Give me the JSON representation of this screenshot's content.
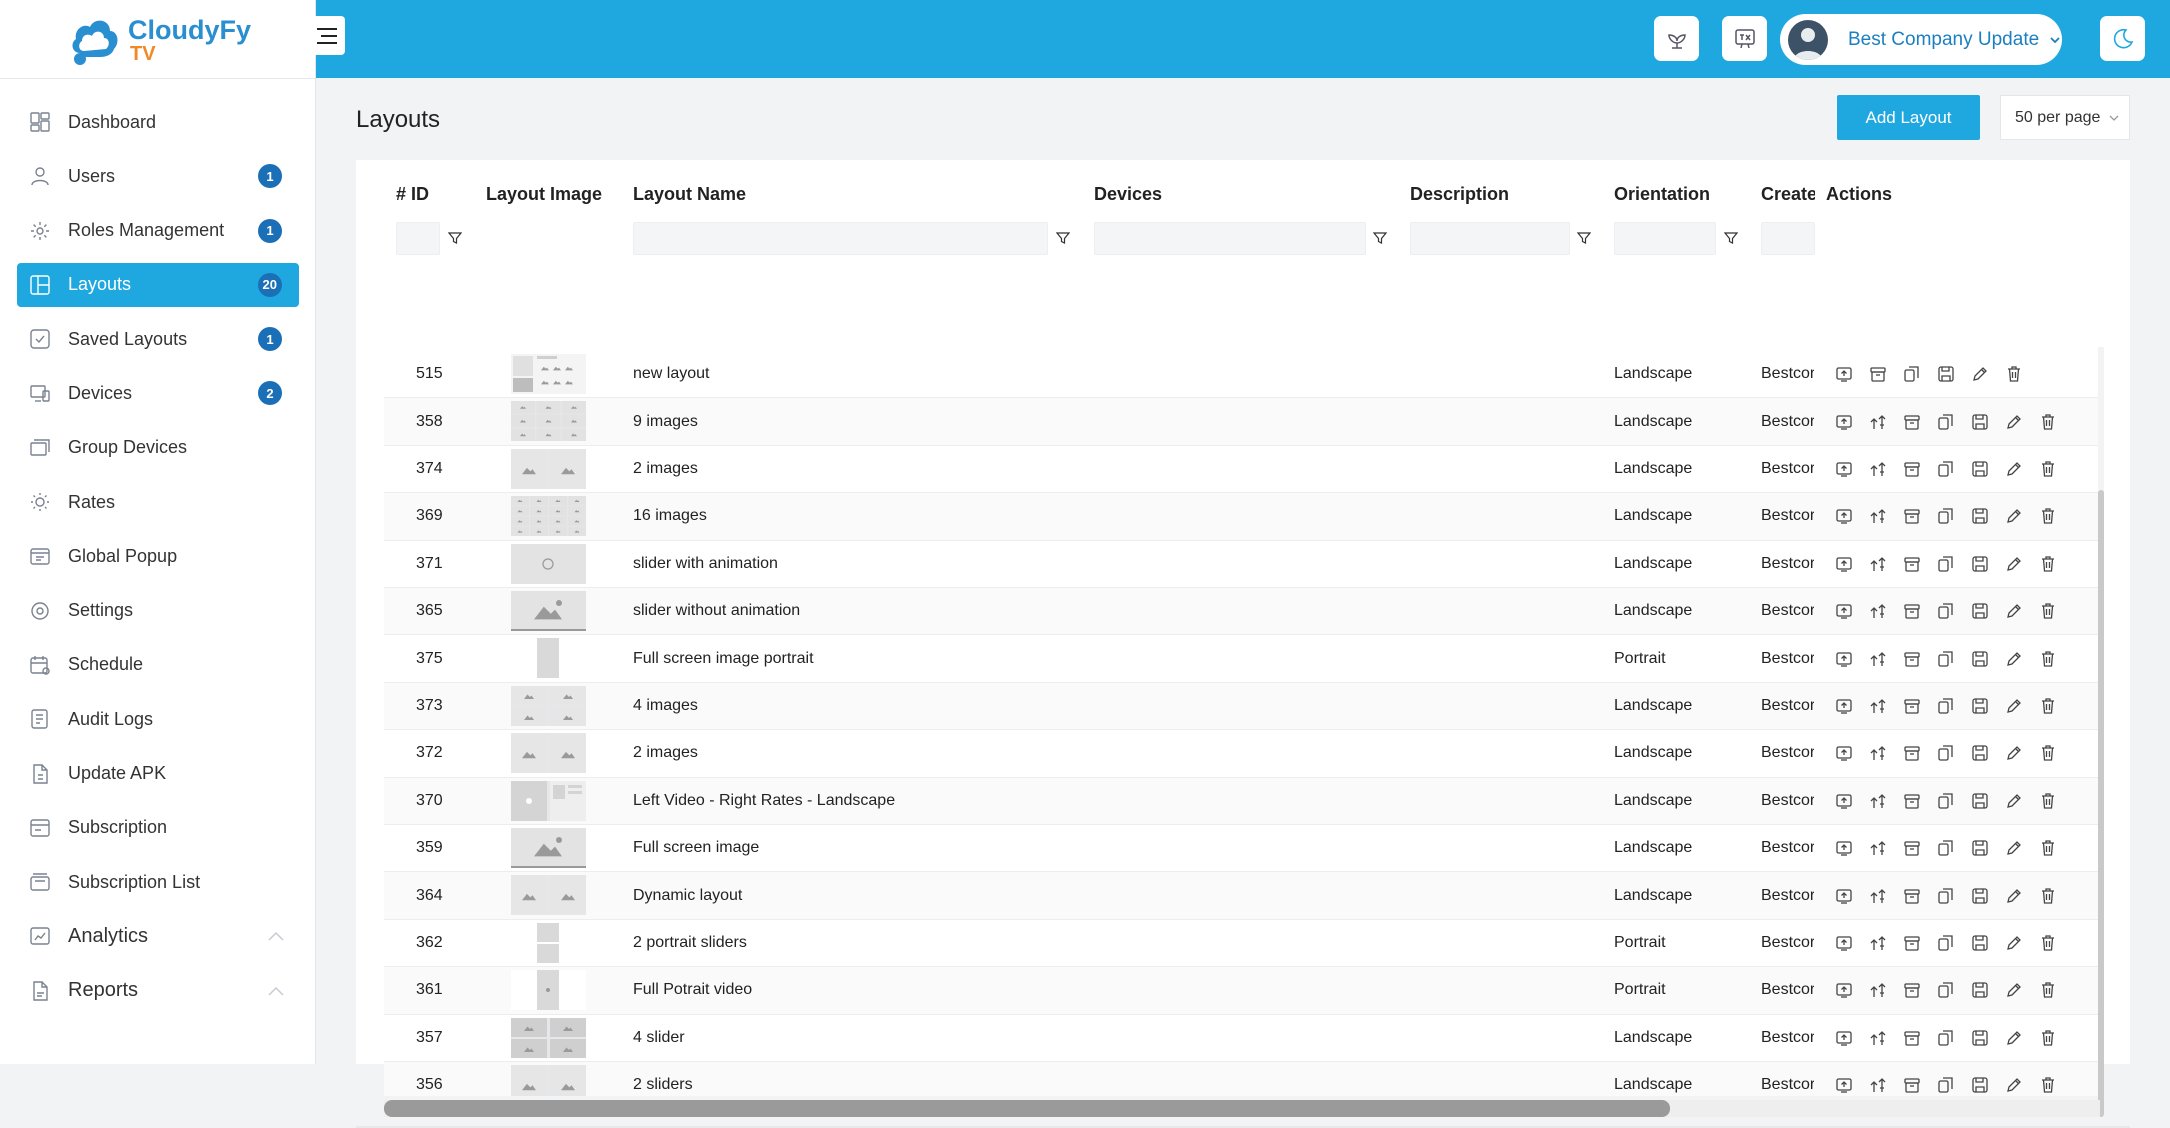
{
  "app": {
    "logo_text_1": "CloudyFy",
    "logo_text_2": "TV",
    "brand_color": "#1fa8e0"
  },
  "sidebar": {
    "items": [
      {
        "label": "Dashboard",
        "icon": "dashboard-icon",
        "badge": ""
      },
      {
        "label": "Users",
        "icon": "users-icon",
        "badge": "1"
      },
      {
        "label": "Roles Management",
        "icon": "roles-icon",
        "badge": "1"
      },
      {
        "label": "Layouts",
        "icon": "layouts-icon",
        "badge": "20",
        "active": true
      },
      {
        "label": "Saved Layouts",
        "icon": "saved-layouts-icon",
        "badge": "1"
      },
      {
        "label": "Devices",
        "icon": "devices-icon",
        "badge": "2"
      },
      {
        "label": "Group Devices",
        "icon": "group-devices-icon",
        "badge": ""
      },
      {
        "label": "Rates",
        "icon": "rates-icon",
        "badge": ""
      },
      {
        "label": "Global Popup",
        "icon": "global-popup-icon",
        "badge": ""
      },
      {
        "label": "Settings",
        "icon": "settings-icon",
        "badge": ""
      },
      {
        "label": "Schedule",
        "icon": "schedule-icon",
        "badge": ""
      },
      {
        "label": "Audit Logs",
        "icon": "audit-logs-icon",
        "badge": ""
      },
      {
        "label": "Update APK",
        "icon": "update-apk-icon",
        "badge": ""
      },
      {
        "label": "Subscription",
        "icon": "subscription-icon",
        "badge": ""
      },
      {
        "label": "Subscription List",
        "icon": "subscription-list-icon",
        "badge": ""
      },
      {
        "label": "Analytics",
        "icon": "analytics-icon",
        "badge": "",
        "expandable": true
      },
      {
        "label": "Reports",
        "icon": "reports-icon",
        "badge": "",
        "expandable": true
      }
    ]
  },
  "topbar": {
    "company_name": "Best Company Update"
  },
  "page": {
    "title": "Layouts",
    "add_button": "Add Layout",
    "per_page": "50 per page"
  },
  "table": {
    "headers": {
      "id": "# ID",
      "image": "Layout Image",
      "name": "Layout Name",
      "devices": "Devices",
      "description": "Description",
      "orientation": "Orientation",
      "created": "Create",
      "actions": "Actions"
    },
    "rows": [
      {
        "id": "515",
        "name": "new layout",
        "orientation": "Landscape",
        "created": "Bestcor",
        "thumb": "complex"
      },
      {
        "id": "358",
        "name": "9 images",
        "orientation": "Landscape",
        "created": "Bestcor",
        "thumb": "grid9"
      },
      {
        "id": "374",
        "name": " 2 images",
        "orientation": "Landscape",
        "created": "Bestcor",
        "thumb": "split2"
      },
      {
        "id": "369",
        "name": "16 images",
        "orientation": "Landscape",
        "created": "Bestcor",
        "thumb": "grid16"
      },
      {
        "id": "371",
        "name": "slider with animation",
        "orientation": "Landscape",
        "created": "Bestcor",
        "thumb": "slider"
      },
      {
        "id": "365",
        "name": "slider without animation",
        "orientation": "Landscape",
        "created": "Bestcor",
        "thumb": "single"
      },
      {
        "id": "375",
        "name": "Full screen image portrait",
        "orientation": "Portrait",
        "created": "Bestcor",
        "thumb": "portrait"
      },
      {
        "id": "373",
        "name": "4 images",
        "orientation": "Landscape",
        "created": "Bestcor",
        "thumb": "grid4"
      },
      {
        "id": "372",
        "name": "2 images",
        "orientation": "Landscape",
        "created": "Bestcor",
        "thumb": "split2"
      },
      {
        "id": "370",
        "name": "Left Video - Right Rates - Landscape",
        "orientation": "Landscape",
        "created": "Bestcor",
        "thumb": "video-rates"
      },
      {
        "id": "359",
        "name": "Full screen image",
        "orientation": "Landscape",
        "created": "Bestcor",
        "thumb": "single"
      },
      {
        "id": "364",
        "name": "Dynamic layout",
        "orientation": "Landscape",
        "created": "Bestcor",
        "thumb": "split2"
      },
      {
        "id": "362",
        "name": "2 portrait sliders",
        "orientation": "Portrait",
        "created": "Bestcor",
        "thumb": "portrait2"
      },
      {
        "id": "361",
        "name": "Full Potrait video",
        "orientation": "Portrait",
        "created": "Bestcor",
        "thumb": "portrait-video"
      },
      {
        "id": "357",
        "name": "4 slider",
        "orientation": "Landscape",
        "created": "Bestcor",
        "thumb": "grid4dark"
      },
      {
        "id": "356",
        "name": "2 sliders",
        "orientation": "Landscape",
        "created": "Bestcor",
        "thumb": "split2"
      }
    ],
    "row_actions": [
      "cast-icon",
      "upload-icon",
      "archive-icon",
      "copy-icon",
      "save-icon",
      "edit-icon",
      "delete-icon"
    ]
  }
}
